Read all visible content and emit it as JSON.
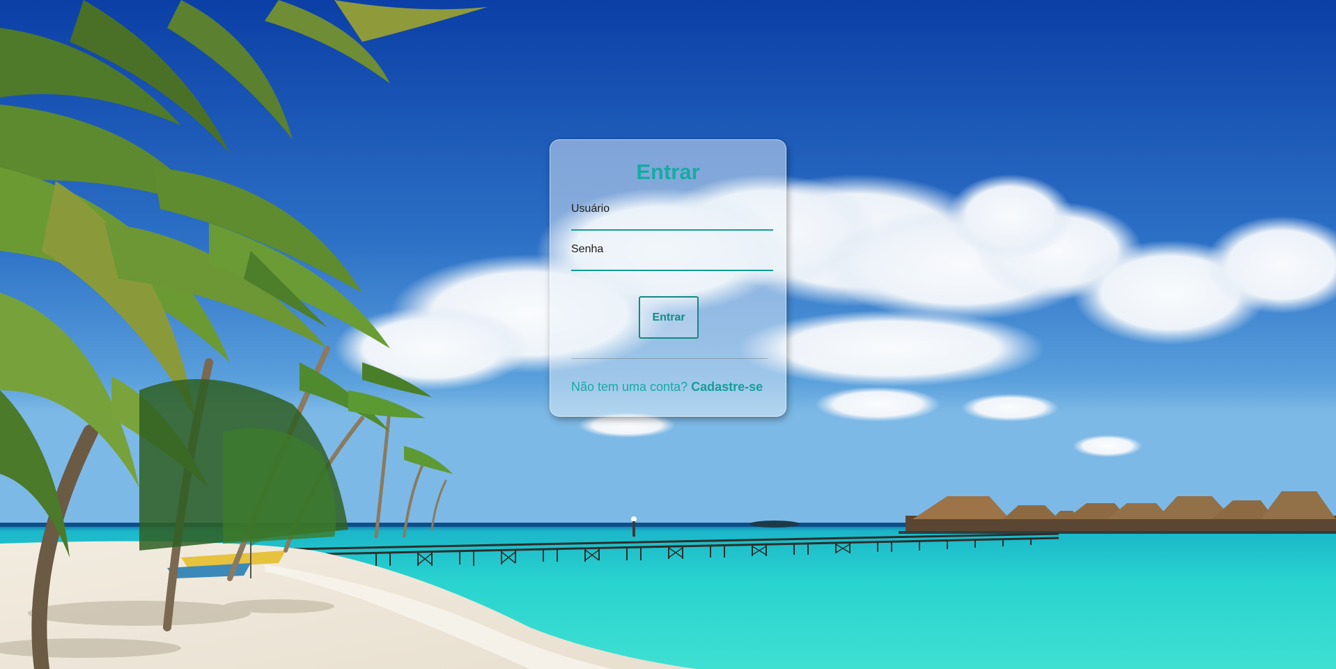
{
  "login": {
    "title": "Entrar",
    "username_label": "Usuário",
    "password_label": "Senha",
    "submit_label": "Entrar",
    "signup_prompt": "Não tem uma conta?",
    "signup_link": "Cadastre-se"
  },
  "colors": {
    "accent": "#17aaa3",
    "button_border": "#12897f",
    "sky_top": "#0d47b3",
    "sea": "#23d4d0"
  }
}
